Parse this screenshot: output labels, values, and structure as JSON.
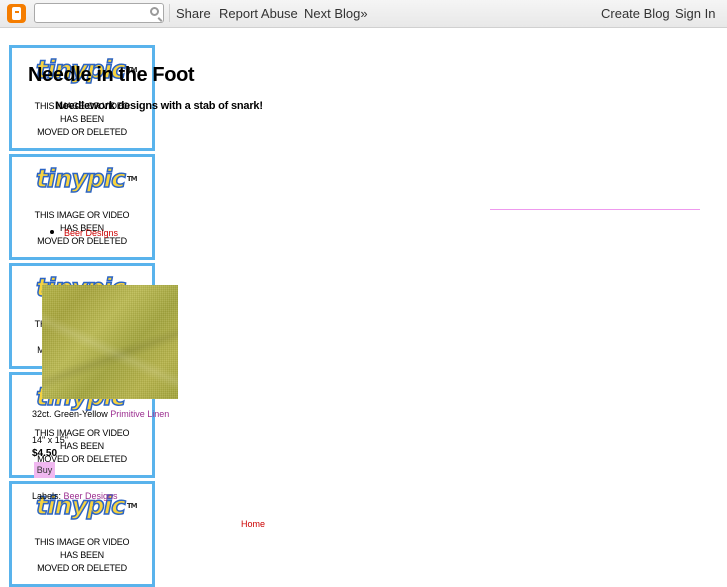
{
  "navbar": {
    "search_placeholder": "",
    "share": "Share",
    "report_abuse": "Report Abuse",
    "next_blog": "Next Blog»",
    "create_blog": "Create Blog",
    "sign_in": "Sign In"
  },
  "tinypic": {
    "logo": "tinypic",
    "tm": "TM",
    "line1": "THIS IMAGE OR VIDEO",
    "line2": "HAS BEEN",
    "line3": "MOVED OR DELETED"
  },
  "blog": {
    "title": "Needle in the Foot",
    "description": "Needlework designs with a stab of snark!"
  },
  "post": {
    "category_link": "Beer Designs",
    "product_prefix": "32ct. Green-Yellow ",
    "product_link": "Primitive Linen",
    "size": "14\" x 15\"",
    "price": "$4.50",
    "buy": "Buy",
    "labels_prefix": "Labels: ",
    "labels_link": "Beer Designs"
  },
  "footer": {
    "home": "Home"
  },
  "colors": {
    "navbar_bg": "#eeeeee",
    "blogger_orange": "#f57d00",
    "tinypic_border": "#59b3ec",
    "link_red": "#cc0000",
    "buy_bg": "#f0b8f0",
    "rule_pink": "#ee99ee"
  }
}
